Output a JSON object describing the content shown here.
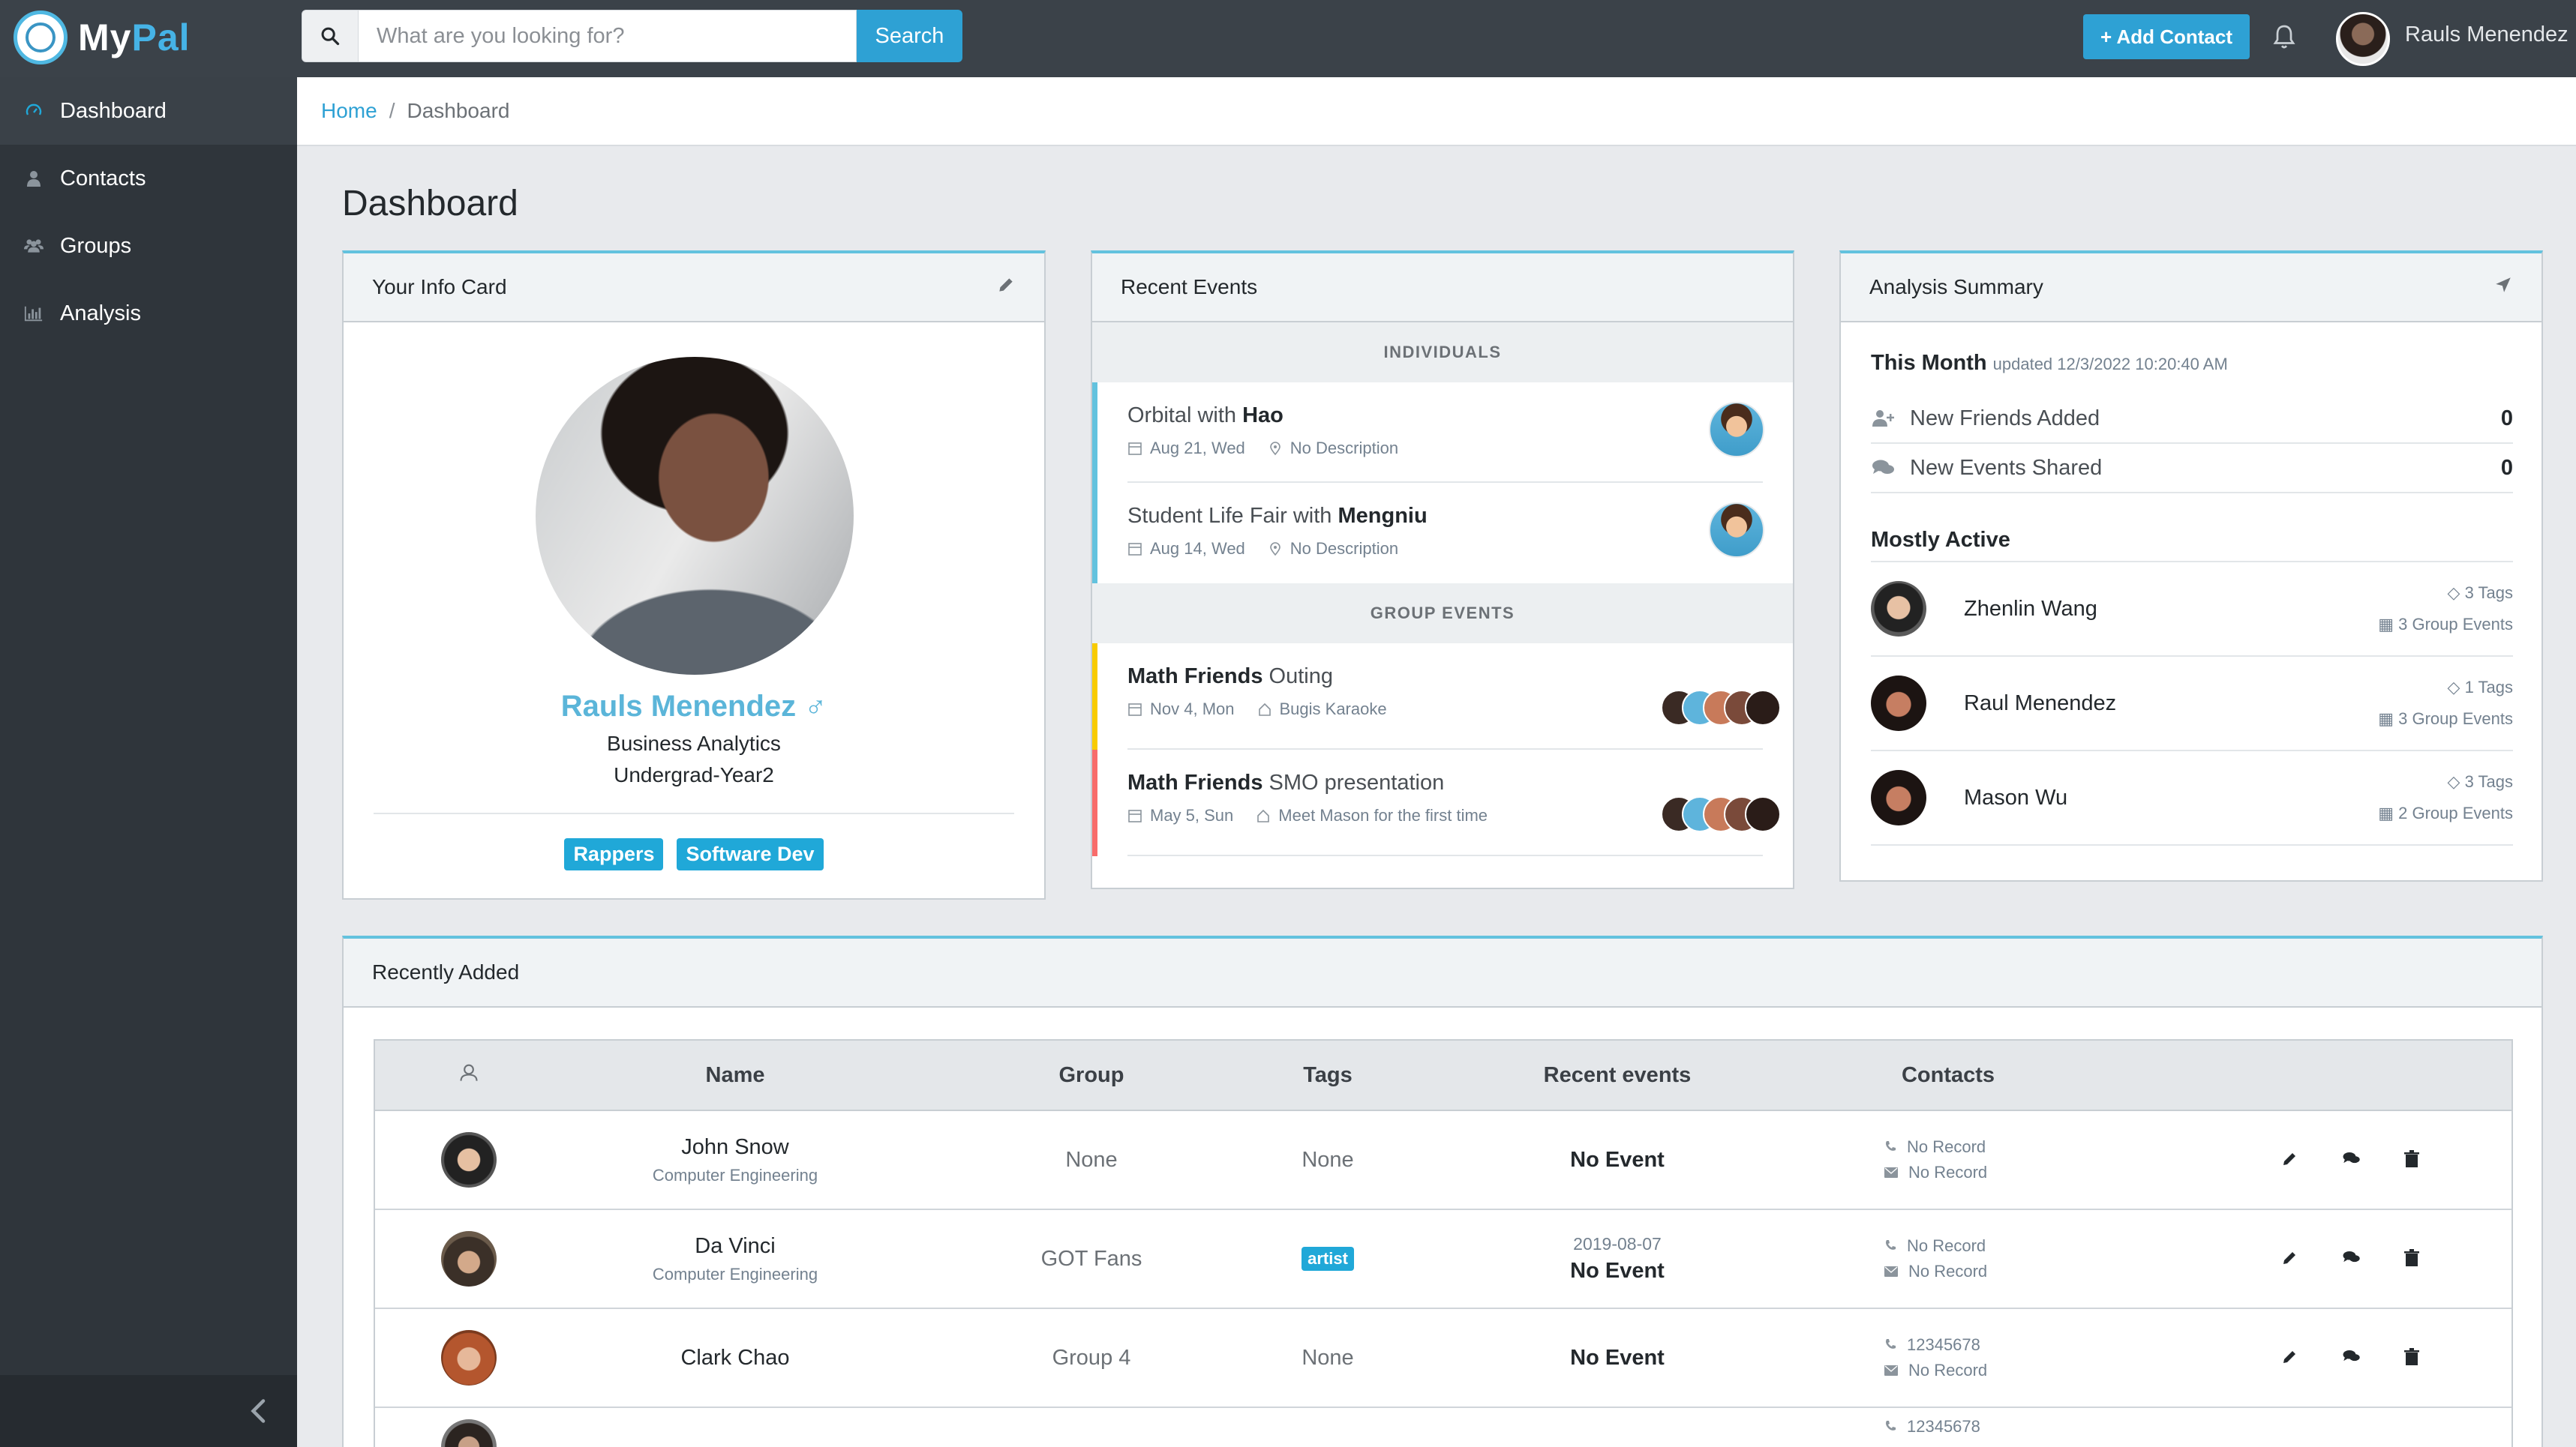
{
  "app": {
    "logo_my": "My",
    "logo_pal": "Pal"
  },
  "search": {
    "placeholder": "What are you looking for?",
    "button": "Search"
  },
  "header": {
    "add_contact": "+ Add Contact",
    "user_name": "Rauls Menendez"
  },
  "sidebar": {
    "items": [
      {
        "label": "Dashboard",
        "icon": "gauge-icon",
        "active": true
      },
      {
        "label": "Contacts",
        "icon": "user-icon"
      },
      {
        "label": "Groups",
        "icon": "users-icon"
      },
      {
        "label": "Analysis",
        "icon": "bar-chart-icon"
      }
    ]
  },
  "breadcrumb": {
    "home": "Home",
    "separator": "/",
    "current": "Dashboard"
  },
  "page": {
    "title": "Dashboard"
  },
  "info_card": {
    "title": "Your Info Card",
    "name": "Rauls Menendez ♂",
    "major": "Business Analytics",
    "year": "Undergrad-Year2",
    "tags": [
      "Rappers",
      "Software Dev"
    ]
  },
  "events": {
    "title": "Recent Events",
    "individuals_label": "INDIVIDUALS",
    "group_label": "GROUP EVENTS",
    "individual": [
      {
        "title": "Orbital with ",
        "who": "Hao",
        "date": "Aug 21, Wed",
        "desc": "No Description"
      },
      {
        "title": "Student Life Fair with ",
        "who": "Mengniu",
        "date": "Aug 14, Wed",
        "desc": "No Description"
      }
    ],
    "group": [
      {
        "group": "Math Friends",
        "title": " Outing",
        "date": "Nov 4, Mon",
        "desc": "Bugis Karaoke"
      },
      {
        "group": "Math Friends",
        "title": " SMO presentation",
        "date": "May 5, Sun",
        "desc": "Meet Mason for the first time"
      }
    ]
  },
  "analysis": {
    "title": "Analysis Summary",
    "this_month": "This Month",
    "updated": "updated 12/3/2022 10:20:40 AM",
    "new_friends_label": "New Friends Added",
    "new_friends_value": "0",
    "new_events_label": "New Events Shared",
    "new_events_value": "0",
    "mostly_active": "Mostly Active",
    "people": [
      {
        "name": "Zhenlin Wang",
        "tags": "3 Tags",
        "events": "3 Group Events"
      },
      {
        "name": "Raul Menendez",
        "tags": "1 Tags",
        "events": "3 Group Events"
      },
      {
        "name": "Mason Wu",
        "tags": "3 Tags",
        "events": "2 Group Events"
      }
    ]
  },
  "recent": {
    "title": "Recently Added",
    "columns": [
      "Name",
      "Group",
      "Tags",
      "Recent events",
      "Contacts"
    ],
    "rows": [
      {
        "name": "John Snow",
        "sub": "Computer Engineering",
        "group": "None",
        "tags": "None",
        "date": "",
        "event": "No Event",
        "phone": "No Record",
        "email": "No Record"
      },
      {
        "name": "Da Vinci",
        "sub": "Computer Engineering",
        "group": "GOT Fans",
        "tags": "artist",
        "date": "2019-08-07",
        "event": "No Event",
        "phone": "No Record",
        "email": "No Record"
      },
      {
        "name": "Clark Chao",
        "sub": "",
        "group": "Group 4",
        "tags": "None",
        "date": "",
        "event": "No Event",
        "phone": "12345678",
        "email": "No Record"
      },
      {
        "phone_partial": "12345678"
      }
    ]
  }
}
